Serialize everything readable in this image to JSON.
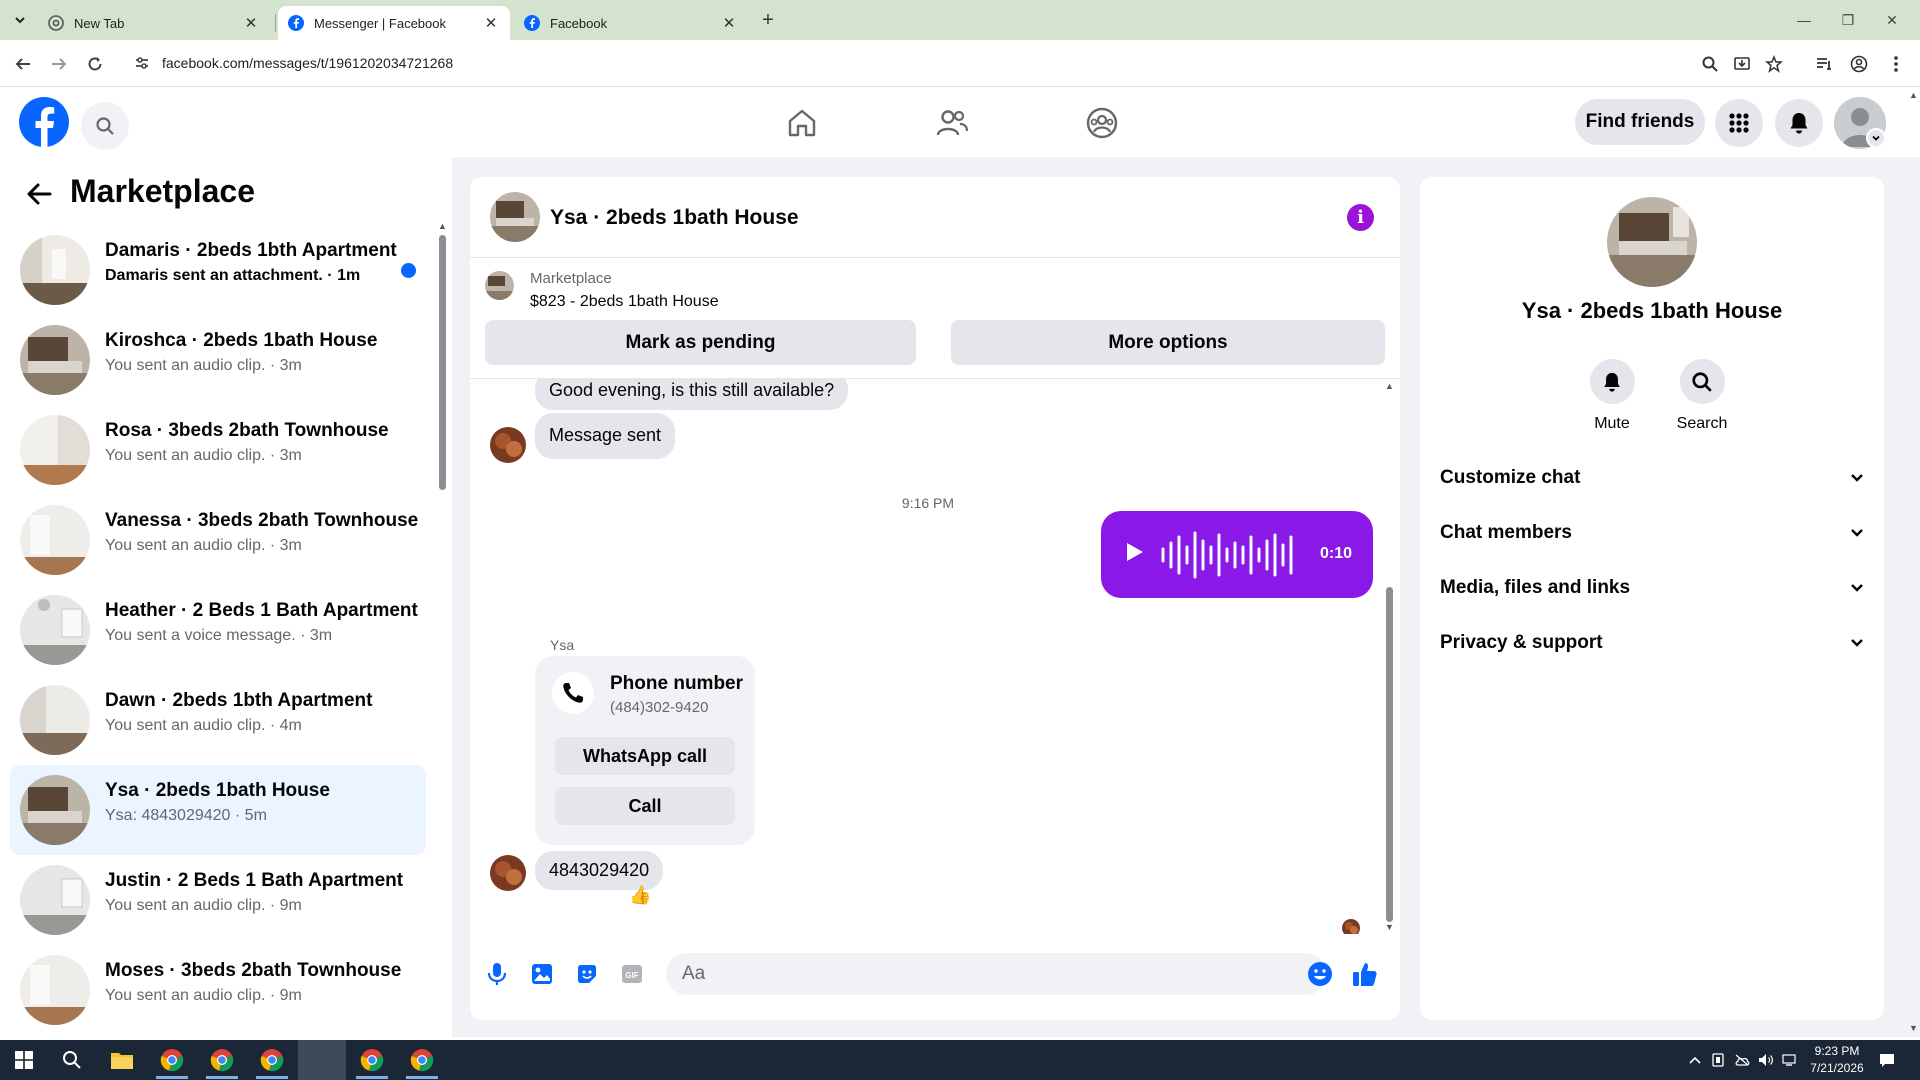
{
  "browser": {
    "tabs": [
      {
        "title": "New Tab",
        "active": false
      },
      {
        "title": "Messenger | Facebook",
        "active": true
      },
      {
        "title": "Facebook",
        "active": false
      }
    ],
    "url": "facebook.com/messages/t/1961202034721268"
  },
  "header": {
    "find_friends_label": "Find friends",
    "accent": "#0866ff"
  },
  "sidebar": {
    "title": "Marketplace",
    "conversations": [
      {
        "name": "Damaris · 2beds 1bth Apartment",
        "preview": "Damaris sent an attachment. · 1m",
        "unread": true,
        "selected": false
      },
      {
        "name": "Kiroshca · 2beds 1bath House",
        "preview": "You sent an audio clip. · 3m",
        "unread": false,
        "selected": false
      },
      {
        "name": "Rosa · 3beds 2bath Townhouse",
        "preview": "You sent an audio clip. · 3m",
        "unread": false,
        "selected": false
      },
      {
        "name": "Vanessa · 3beds 2bath Townhouse",
        "preview": "You sent an audio clip. · 3m",
        "unread": false,
        "selected": false
      },
      {
        "name": "Heather · 2 Beds 1 Bath Apartment",
        "preview": "You sent a voice message. · 3m",
        "unread": false,
        "selected": false
      },
      {
        "name": "Dawn · 2beds 1bth Apartment",
        "preview": "You sent an audio clip. · 4m",
        "unread": false,
        "selected": false
      },
      {
        "name": "Ysa · 2beds 1bath House",
        "preview": "Ysa: 4843029420 · 5m",
        "unread": false,
        "selected": true
      },
      {
        "name": "Justin · 2 Beds 1 Bath Apartment",
        "preview": "You sent an audio clip. · 9m",
        "unread": false,
        "selected": false
      },
      {
        "name": "Moses · 3beds 2bath Townhouse",
        "preview": "You sent an audio clip. · 9m",
        "unread": false,
        "selected": false
      }
    ]
  },
  "chat": {
    "title": "Ysa · 2beds 1bath House",
    "listing": {
      "source": "Marketplace",
      "title": "$823 - 2beds 1bath House",
      "mark_pending_label": "Mark as pending",
      "more_options_label": "More options"
    },
    "messages": {
      "partial_top": "Good evening, is this still available?",
      "message_sent": "Message sent",
      "timestamp": "9:16 PM",
      "audio_duration": "0:10",
      "sender_name": "Ysa",
      "phone_card": {
        "label": "Phone number",
        "number": "(484)302-9420",
        "whatsapp_label": "WhatsApp call",
        "call_label": "Call"
      },
      "last_message": "4843029420",
      "reaction": "👍"
    },
    "composer_placeholder": "Aa",
    "audio_color": "#8a18e6",
    "info_color": "#9b13d8"
  },
  "info_panel": {
    "title": "Ysa · 2beds 1bath House",
    "actions": [
      {
        "label": "Mute",
        "icon": "bell-icon"
      },
      {
        "label": "Search",
        "icon": "search-icon"
      }
    ],
    "sections": [
      "Customize chat",
      "Chat members",
      "Media, files and links",
      "Privacy & support"
    ]
  },
  "taskbar": {
    "time": "9:23 PM",
    "date": "7/21/2026"
  }
}
